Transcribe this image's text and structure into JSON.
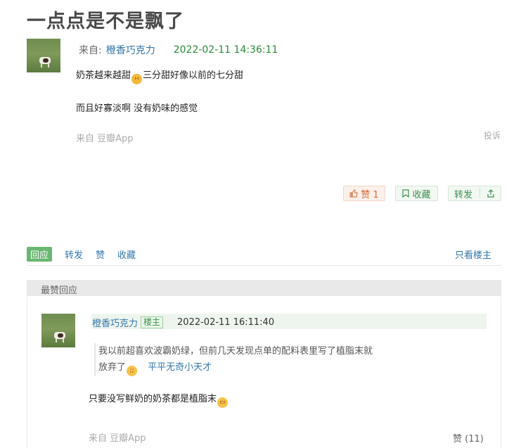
{
  "post": {
    "title": "一点点是不是飘了",
    "from_label": "来自:",
    "author": "橙香巧克力",
    "time": "2022-02-11 14:36:11",
    "line1_a": "奶茶越来越甜",
    "line1_b": "三分甜好像以前的七分甜",
    "line2": "而且好寡淡啊 没有奶味的感觉",
    "source": "来自 豆瓣App",
    "report": "投诉",
    "like_label": "赞 1",
    "collect_label": "收藏",
    "share_label": "转发"
  },
  "tabs": {
    "reply": "回应",
    "forward": "转发",
    "like": "赞",
    "collect": "收藏",
    "only_op": "只看楼主"
  },
  "top_replies": {
    "header": "最赞回应",
    "reply": {
      "author": "橙香巧克力",
      "badge": "楼主",
      "time": "2022-02-11 16:11:40",
      "quote_line1": "我以前超喜欢波霸奶绿，但前几天发现点单的配料表里写了植脂末就",
      "quote_line2": "放弃了",
      "quote_author": "平平无奇小天才",
      "text": "只要没写鲜奶的奶茶都是植脂末",
      "source": "来自 豆瓣App",
      "likes": "赞 (11)"
    }
  },
  "colors": {
    "link": "#3377aa",
    "green_time": "#2a8a3a",
    "accent_green": "#69b672"
  }
}
